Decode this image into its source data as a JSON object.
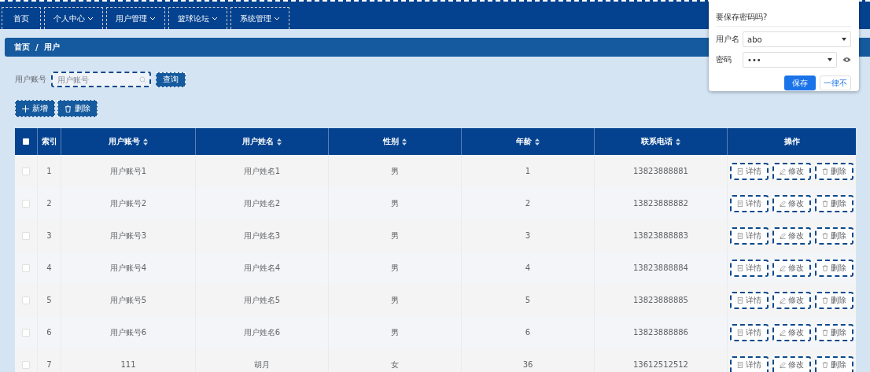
{
  "nav": [
    {
      "label": "首页",
      "has_menu": false
    },
    {
      "label": "个人中心",
      "has_menu": true
    },
    {
      "label": "用户管理",
      "has_menu": true
    },
    {
      "label": "篮球论坛",
      "has_menu": true
    },
    {
      "label": "系统管理",
      "has_menu": true
    }
  ],
  "breadcrumb": [
    "首页",
    "/",
    "用户"
  ],
  "search": {
    "label": "用户账号",
    "placeholder": "用户账号",
    "button": "查询"
  },
  "toolbar": [
    {
      "label": "新增",
      "kind": "add"
    },
    {
      "label": "删除",
      "kind": "delete"
    }
  ],
  "table": {
    "select_all": {
      "checked": false
    },
    "columns": [
      {
        "label": "索引",
        "sortable": false
      },
      {
        "label": "用户账号",
        "sortable": true
      },
      {
        "label": "用户姓名",
        "sortable": true
      },
      {
        "label": "性别",
        "sortable": true
      },
      {
        "label": "年龄",
        "sortable": true
      },
      {
        "label": "联系电话",
        "sortable": true
      },
      {
        "label": "操作",
        "sortable": false
      }
    ],
    "rows": [
      {
        "checked": false,
        "cells": [
          "1",
          "用户账号1",
          "用户姓名1",
          "男",
          "1",
          "13823888881"
        ],
        "actions": [
          {
            "label": "详情",
            "kind": "detail"
          },
          {
            "label": "修改",
            "kind": "edit"
          },
          {
            "label": "删除",
            "kind": "delete"
          }
        ]
      },
      {
        "checked": false,
        "cells": [
          "2",
          "用户账号2",
          "用户姓名2",
          "男",
          "2",
          "13823888882"
        ],
        "actions": [
          {
            "label": "详情",
            "kind": "detail"
          },
          {
            "label": "修改",
            "kind": "edit"
          },
          {
            "label": "删除",
            "kind": "delete"
          }
        ]
      },
      {
        "checked": false,
        "cells": [
          "3",
          "用户账号3",
          "用户姓名3",
          "男",
          "3",
          "13823888883"
        ],
        "actions": [
          {
            "label": "详情",
            "kind": "detail"
          },
          {
            "label": "修改",
            "kind": "edit"
          },
          {
            "label": "删除",
            "kind": "delete"
          }
        ]
      },
      {
        "checked": false,
        "cells": [
          "4",
          "用户账号4",
          "用户姓名4",
          "男",
          "4",
          "13823888884"
        ],
        "actions": [
          {
            "label": "详情",
            "kind": "detail"
          },
          {
            "label": "修改",
            "kind": "edit"
          },
          {
            "label": "删除",
            "kind": "delete"
          }
        ]
      },
      {
        "checked": false,
        "cells": [
          "5",
          "用户账号5",
          "用户姓名5",
          "男",
          "5",
          "13823888885"
        ],
        "actions": [
          {
            "label": "详情",
            "kind": "detail"
          },
          {
            "label": "修改",
            "kind": "edit"
          },
          {
            "label": "删除",
            "kind": "delete"
          }
        ]
      },
      {
        "checked": false,
        "cells": [
          "6",
          "用户账号6",
          "用户姓名6",
          "男",
          "6",
          "13823888886"
        ],
        "actions": [
          {
            "label": "详情",
            "kind": "detail"
          },
          {
            "label": "修改",
            "kind": "edit"
          },
          {
            "label": "删除",
            "kind": "delete"
          }
        ]
      },
      {
        "checked": false,
        "cells": [
          "7",
          "111",
          "胡月",
          "女",
          "36",
          "13612512512"
        ],
        "actions": [
          {
            "label": "详情",
            "kind": "detail"
          },
          {
            "label": "修改",
            "kind": "edit"
          },
          {
            "label": "删除",
            "kind": "delete"
          }
        ]
      }
    ]
  },
  "password_popup": {
    "title": "要保存密码吗?",
    "username_label": "用户名",
    "username": "abo",
    "password_label": "密码",
    "password": "•••",
    "save": "保存",
    "never": "一律不"
  }
}
